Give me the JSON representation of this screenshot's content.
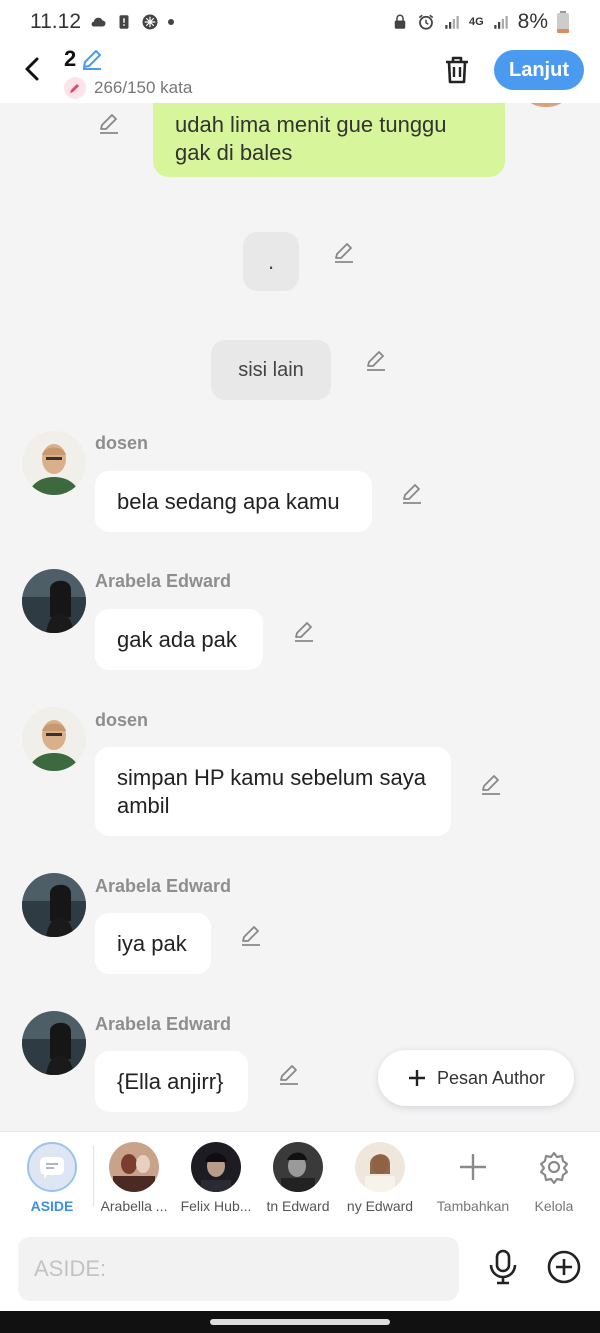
{
  "status_bar": {
    "time": "11.12",
    "battery": "8%",
    "network": "4G",
    "left_icons": [
      "cloud-icon",
      "sim-alert-icon",
      "vpn-icon",
      "dot-icon"
    ],
    "right_icons": [
      "lock-icon",
      "alarm-icon",
      "signal-icon",
      "signal-icon",
      "battery-icon"
    ]
  },
  "header": {
    "episode_number": "2",
    "word_count": "266/150 kata",
    "next_label": "Lanjut",
    "accent_color": "#4a9bf0"
  },
  "messages": [
    {
      "type": "outgoing",
      "text": "udah lima menit gue tunggu gak di bales"
    },
    {
      "type": "narration",
      "text": "."
    },
    {
      "type": "narration",
      "text": "sisi lain"
    },
    {
      "type": "incoming",
      "sender": "dosen",
      "text": "bela sedang apa kamu"
    },
    {
      "type": "incoming",
      "sender": "Arabela Edward",
      "text": "gak ada pak"
    },
    {
      "type": "incoming",
      "sender": "dosen",
      "text": "simpan HP kamu sebelum saya ambil"
    },
    {
      "type": "incoming",
      "sender": "Arabela Edward",
      "text": "iya pak"
    },
    {
      "type": "incoming",
      "sender": "Arabela Edward",
      "text": "{Ella anjirr}"
    }
  ],
  "fab": {
    "label": "Pesan Author"
  },
  "characters": [
    {
      "label": "ASIDE",
      "active": true
    },
    {
      "label": "Arabella ..."
    },
    {
      "label": "Felix Hub..."
    },
    {
      "label": "tn Edward"
    },
    {
      "label": "ny Edward"
    },
    {
      "label": "Tambahkan"
    },
    {
      "label": "Kelola"
    }
  ],
  "input": {
    "placeholder": "ASIDE:"
  }
}
